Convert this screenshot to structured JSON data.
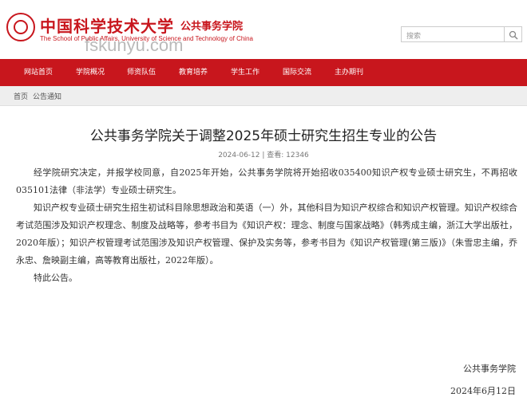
{
  "header": {
    "university_name": "中国科学技术大学",
    "school_name": "公共事务学院",
    "school_name_en": "The School of Public Affairs, University of Science and Technology of China",
    "watermark": "fskunyu.com",
    "search_placeholder": "搜索",
    "logo_icon": "university-seal-icon",
    "search_icon": "search-icon"
  },
  "nav": {
    "items": [
      "网站首页",
      "学院概况",
      "师资队伍",
      "教育培养",
      "学生工作",
      "国际交流",
      "主办期刊"
    ]
  },
  "breadcrumb": {
    "home": "首页",
    "current": "公告通知"
  },
  "article": {
    "title": "公共事务学院关于调整2025年硕士研究生招生专业的公告",
    "meta": "2024-06-12 | 查看: 12346",
    "paragraphs": [
      "经学院研究决定，并报学校同意，自2025年开始，公共事务学院将开始招收035400知识产权专业硕士研究生，不再招收035101法律（非法学）专业硕士研究生。",
      "知识产权专业硕士研究生招生初试科目除思想政治和英语（一）外，其他科目为知识产权综合和知识产权管理。知识产权综合考试范围涉及知识产权理念、制度及战略等，参考书目为《知识产权：理念、制度与国家战略》（韩秀成主编，浙江大学出版社，2020年版）；知识产权管理考试范围涉及知识产权管理、保护及实务等，参考书目为《知识产权管理(第三版)》（朱雪忠主编，乔永忠、詹映副主编，高等教育出版社，2022年版）。",
      "特此公告。"
    ],
    "signature": "公共事务学院",
    "date": "2024年6月12日"
  },
  "colors": {
    "brand_red": "#c8161d",
    "breadcrumb_bg": "#eeeeee"
  }
}
